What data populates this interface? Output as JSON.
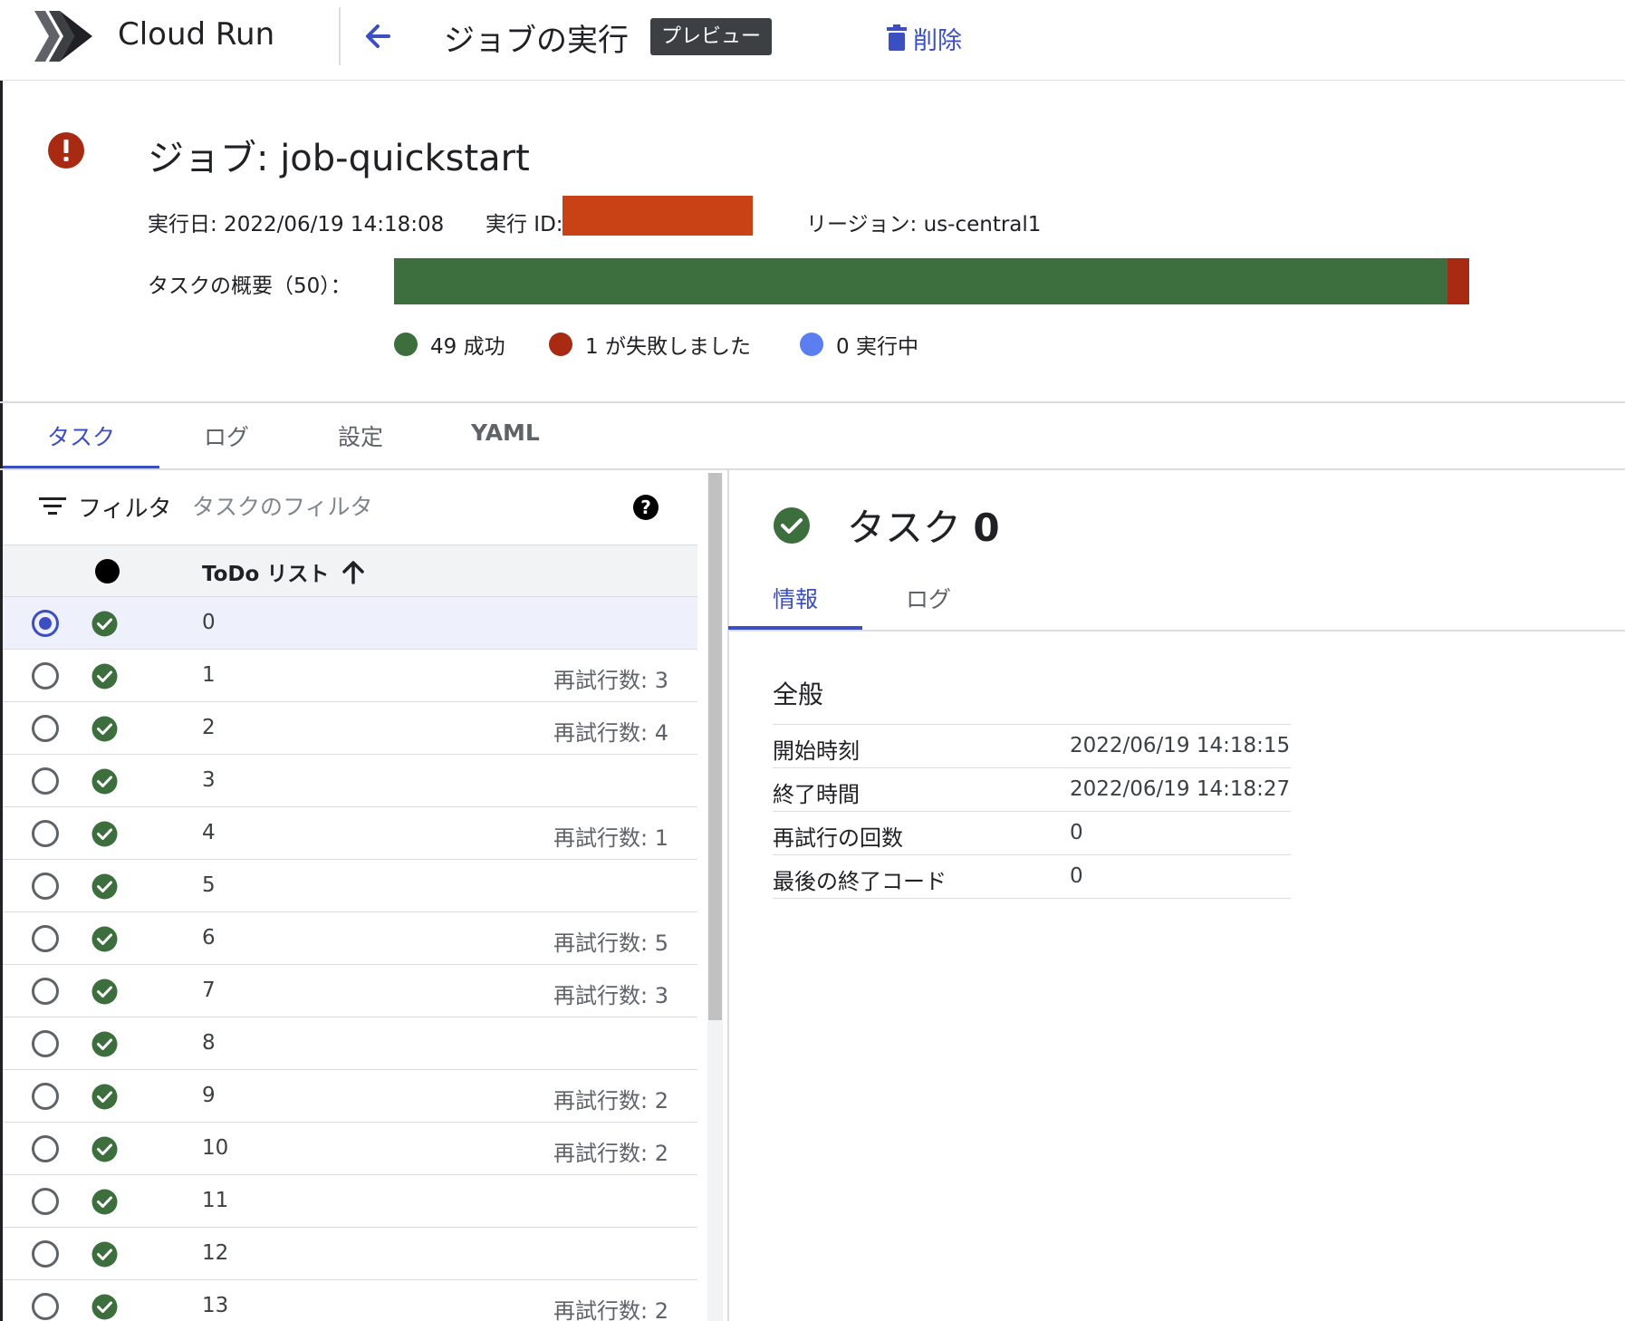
{
  "app": {
    "product_name": "Cloud Run"
  },
  "topbar": {
    "page_title": "ジョブの実行",
    "badge": "プレビュー",
    "delete_label": "削除"
  },
  "colors": {
    "accent": "#3c4fc1",
    "success": "#3d6f3e",
    "failed": "#a82a12",
    "running": "#5b7ff0"
  },
  "job": {
    "title": "ジョブ: job-quickstart",
    "executed_at": "実行日: 2022/06/19 14:18:08",
    "execution_id_label": "実行 ID:",
    "region": "リージョン: us-central1",
    "task_summary_label": "タスクの概要（50）：",
    "tasks_total": 50,
    "tasks_succeeded": 49,
    "tasks_failed": 1,
    "tasks_running": 0,
    "legend": {
      "success": "49 成功",
      "failed": "1 が失敗しました",
      "running": "0 実行中"
    }
  },
  "tabs": [
    {
      "label": "タスク",
      "active": true
    },
    {
      "label": "ログ",
      "active": false
    },
    {
      "label": "設定",
      "active": false
    },
    {
      "label": "YAML",
      "active": false
    }
  ],
  "filter": {
    "label": "フィルタ",
    "placeholder": "タスクのフィルタ"
  },
  "table": {
    "column_label": "ToDo リスト",
    "rows": [
      {
        "index": "0",
        "retries": "",
        "selected": true
      },
      {
        "index": "1",
        "retries": "再試行数: 3",
        "selected": false
      },
      {
        "index": "2",
        "retries": "再試行数: 4",
        "selected": false
      },
      {
        "index": "3",
        "retries": "",
        "selected": false
      },
      {
        "index": "4",
        "retries": "再試行数: 1",
        "selected": false
      },
      {
        "index": "5",
        "retries": "",
        "selected": false
      },
      {
        "index": "6",
        "retries": "再試行数: 5",
        "selected": false
      },
      {
        "index": "7",
        "retries": "再試行数: 3",
        "selected": false
      },
      {
        "index": "8",
        "retries": "",
        "selected": false
      },
      {
        "index": "9",
        "retries": "再試行数: 2",
        "selected": false
      },
      {
        "index": "10",
        "retries": "再試行数: 2",
        "selected": false
      },
      {
        "index": "11",
        "retries": "",
        "selected": false
      },
      {
        "index": "12",
        "retries": "",
        "selected": false
      },
      {
        "index": "13",
        "retries": "再試行数: 2",
        "selected": false
      }
    ]
  },
  "detail": {
    "title_prefix": "タスク",
    "title_number": "0",
    "subtabs": [
      {
        "label": "情報",
        "active": true
      },
      {
        "label": "ログ",
        "active": false
      }
    ],
    "general_heading": "全般",
    "info": [
      {
        "key": "開始時刻",
        "value": "2022/06/19 14:18:15"
      },
      {
        "key": "終了時間",
        "value": "2022/06/19 14:18:27"
      },
      {
        "key": "再試行の回数",
        "value": "0"
      },
      {
        "key": "最後の終了コード",
        "value": "0"
      }
    ]
  }
}
